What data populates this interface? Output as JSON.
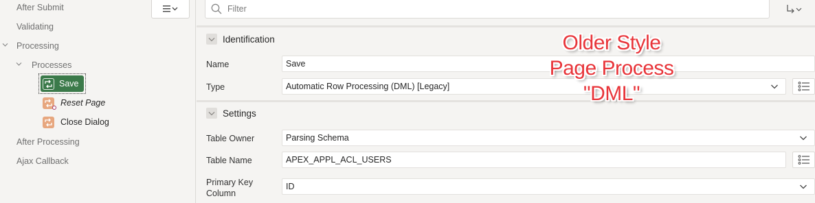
{
  "tree": {
    "after_submit": "After Submit",
    "validating": "Validating",
    "processing": "Processing",
    "processes": "Processes",
    "save": "Save",
    "reset_page": "Reset Page",
    "close_dialog": "Close Dialog",
    "after_processing": "After Processing",
    "ajax_callback": "Ajax Callback"
  },
  "filter": {
    "placeholder": "Filter"
  },
  "sections": {
    "identification": "Identification",
    "settings": "Settings"
  },
  "properties": {
    "name_label": "Name",
    "name_value": "Save",
    "type_label": "Type",
    "type_value": "Automatic Row Processing (DML) [Legacy]",
    "table_owner_label": "Table Owner",
    "table_owner_value": "Parsing Schema",
    "table_name_label": "Table Name",
    "table_name_value": "APEX_APPL_ACL_USERS",
    "pk_label_line1": "Primary Key",
    "pk_label_line2": "Column",
    "pk_value": "ID"
  },
  "annotation": {
    "line1": "Older Style",
    "line2": "Page Process",
    "line3": "\"DML\""
  },
  "colors": {
    "selected_node": "#3b7a4a",
    "process_icon": "#e7a77f",
    "annotation_text": "#e8353a"
  },
  "icons": [
    "hamburger-menu-icon",
    "chevron-down-icon",
    "search-icon",
    "goto-arrow-icon",
    "process-icon",
    "list-of-values-icon",
    "collapse-toggle-icon"
  ]
}
